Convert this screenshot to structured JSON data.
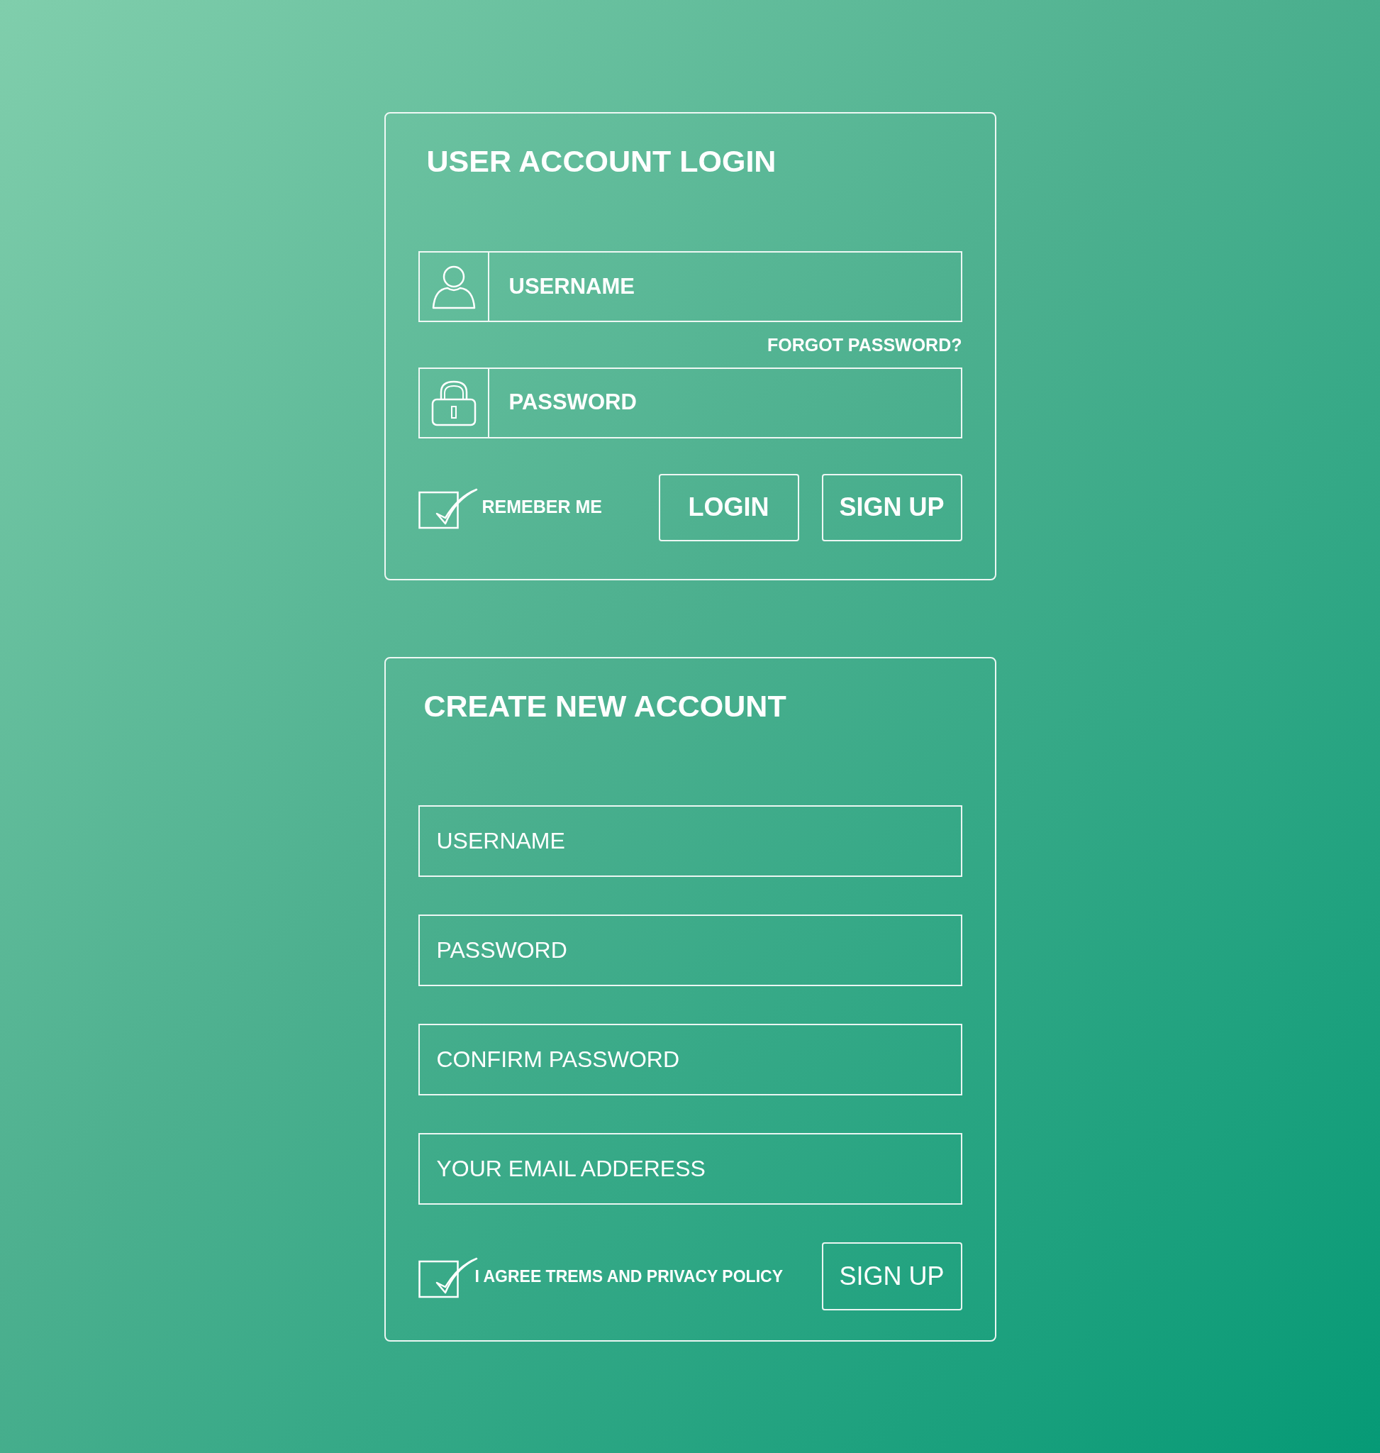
{
  "login": {
    "title": "USER ACCOUNT LOGIN",
    "username": {
      "placeholder": "USERNAME"
    },
    "forgot_link": "FORGOT PASSWORD?",
    "password": {
      "placeholder": "PASSWORD"
    },
    "remember": {
      "label": "REMEBER ME",
      "checked": true
    },
    "buttons": [
      "LOGIN",
      "SIGN UP"
    ]
  },
  "signup": {
    "title": "CREATE NEW ACCOUNT",
    "fields": [
      {
        "placeholder": "USERNAME"
      },
      {
        "placeholder": "PASSWORD"
      },
      {
        "placeholder": "CONFIRM PASSWORD"
      },
      {
        "placeholder": "YOUR EMAIL ADDERESS"
      }
    ],
    "agree": {
      "label": "I AGREE TREMS AND PRIVACY POLICY",
      "checked": true
    },
    "button": "SIGN UP"
  }
}
